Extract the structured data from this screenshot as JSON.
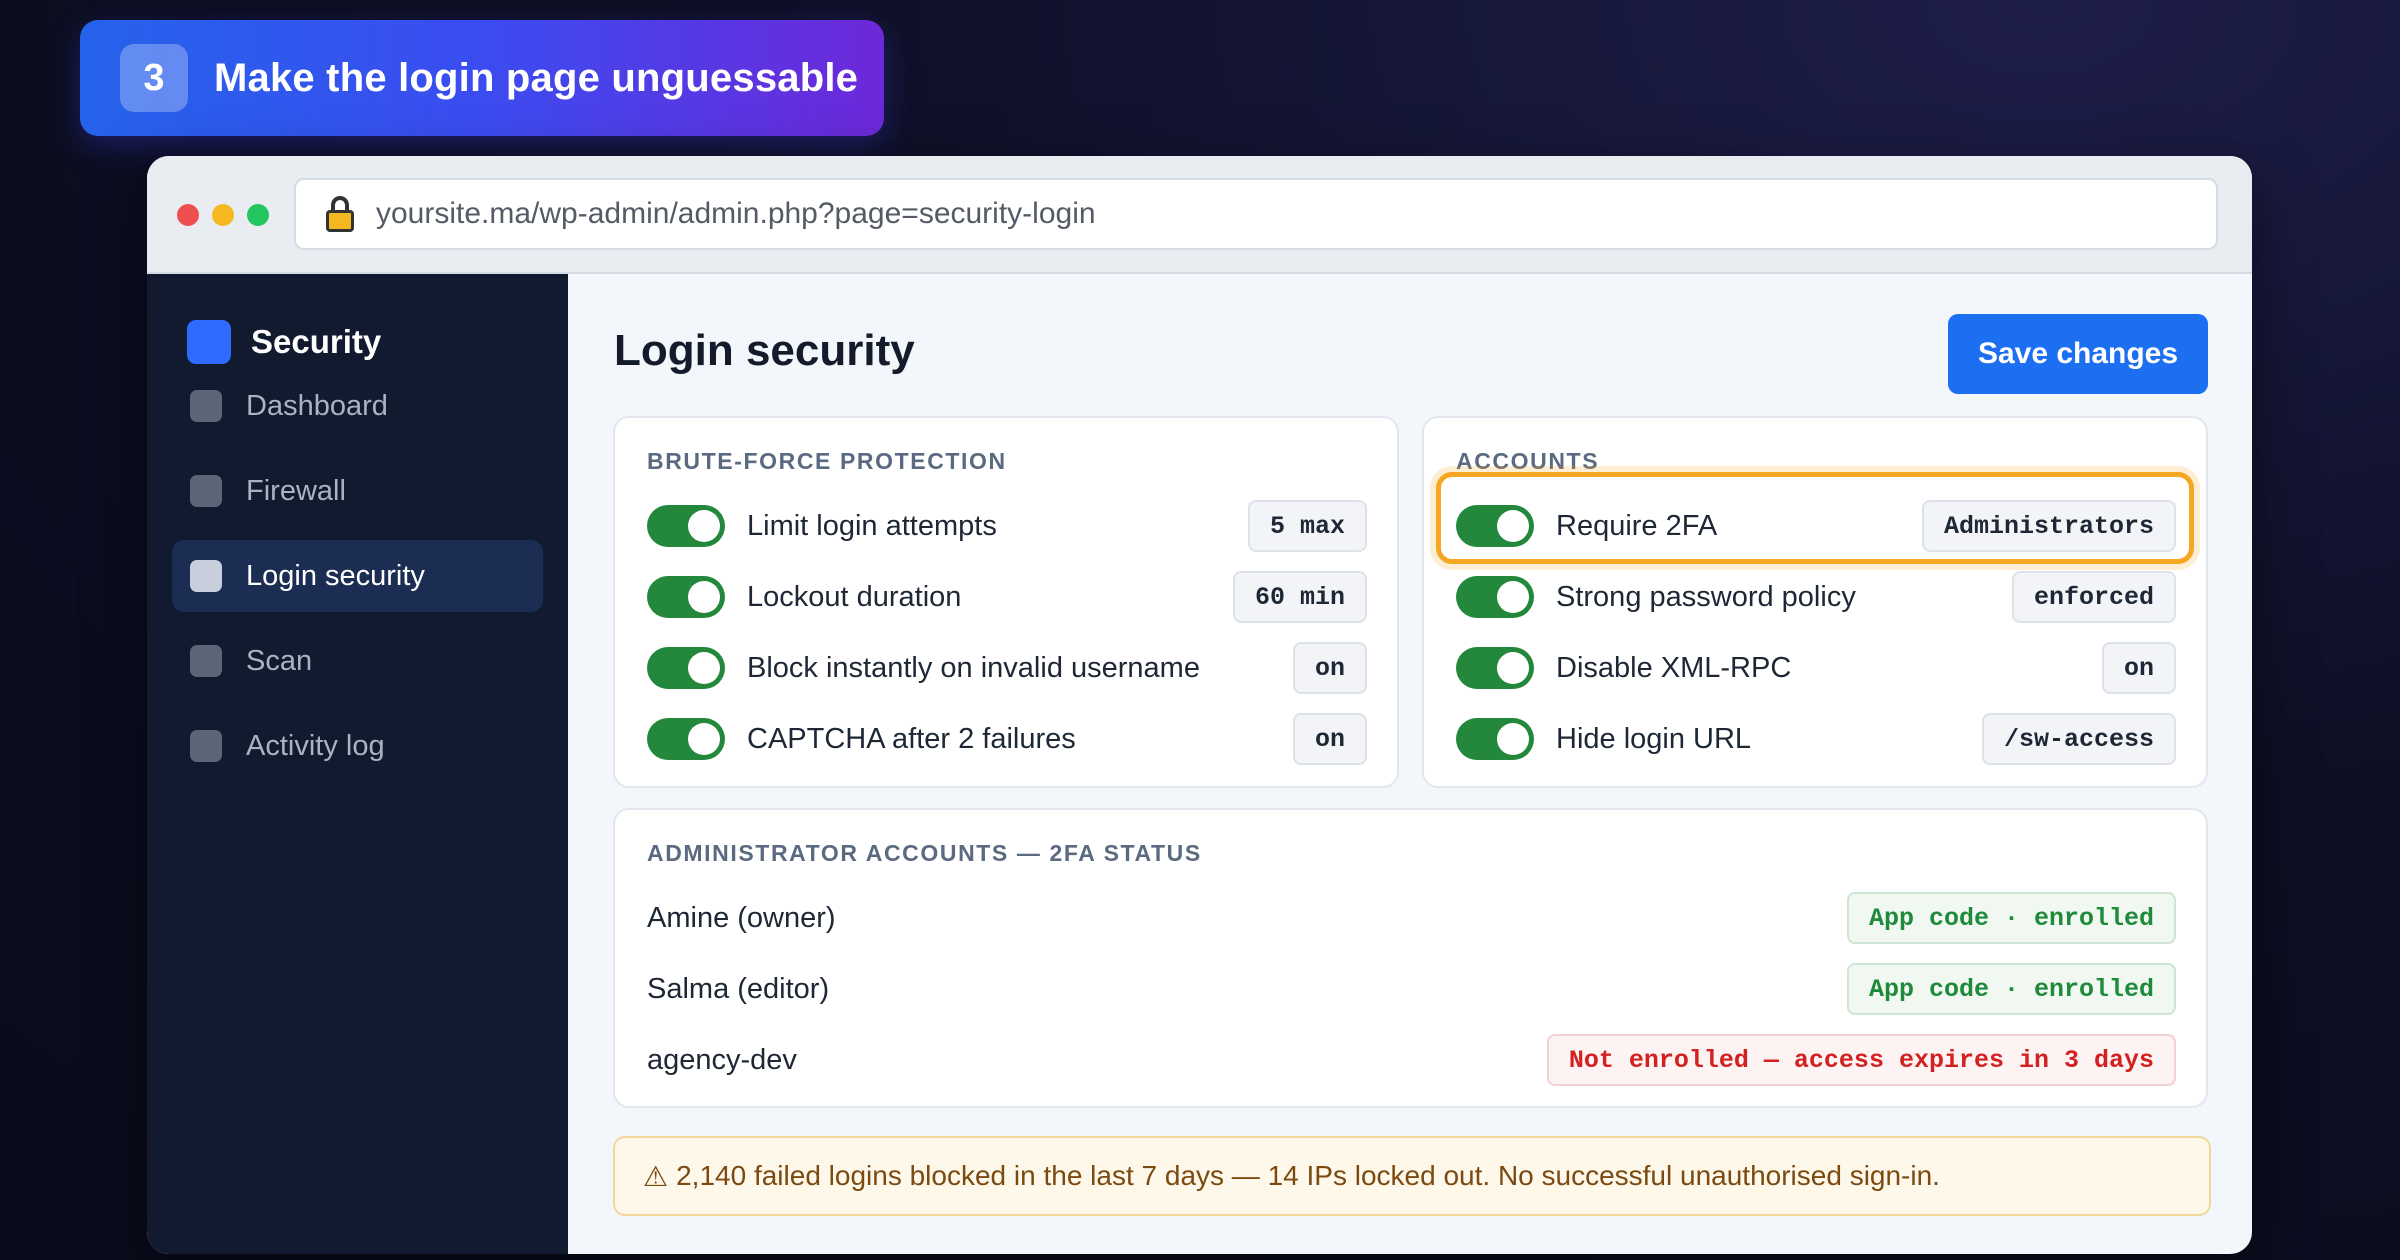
{
  "step": {
    "number": "3",
    "title": "Make the login page unguessable"
  },
  "browser": {
    "url": "yoursite.ma/wp-admin/admin.php?page=security-login"
  },
  "sidebar": {
    "brand": "Security",
    "items": [
      {
        "label": "Dashboard"
      },
      {
        "label": "Firewall"
      },
      {
        "label": "Login security"
      },
      {
        "label": "Scan"
      },
      {
        "label": "Activity log"
      }
    ]
  },
  "main": {
    "title": "Login security",
    "save_label": "Save changes",
    "brute_force": {
      "heading": "BRUTE-FORCE PROTECTION",
      "rows": [
        {
          "label": "Limit login attempts",
          "value": "5 max",
          "enabled": true
        },
        {
          "label": "Lockout duration",
          "value": "60 min",
          "enabled": true
        },
        {
          "label": "Block instantly on invalid username",
          "value": "on",
          "enabled": true
        },
        {
          "label": "CAPTCHA after 2 failures",
          "value": "on",
          "enabled": true
        }
      ]
    },
    "accounts": {
      "heading": "ACCOUNTS",
      "rows": [
        {
          "label": "Require 2FA",
          "value": "Administrators",
          "enabled": true,
          "highlighted": true
        },
        {
          "label": "Strong password policy",
          "value": "enforced",
          "enabled": true
        },
        {
          "label": "Disable XML-RPC",
          "value": "on",
          "enabled": true
        },
        {
          "label": "Hide login URL",
          "value": "/sw-access",
          "enabled": true
        }
      ]
    },
    "admins": {
      "heading": "ADMINISTRATOR ACCOUNTS — 2FA STATUS",
      "rows": [
        {
          "name": "Amine (owner)",
          "status": "App code · enrolled",
          "state": "ok"
        },
        {
          "name": "Salma (editor)",
          "status": "App code · enrolled",
          "state": "ok"
        },
        {
          "name": "agency-dev",
          "status": "Not enrolled — access expires in 3 days",
          "state": "bad"
        }
      ]
    },
    "alert": {
      "icon": "⚠",
      "text": "2,140 failed logins blocked in the last 7 days — 14 IPs locked out. No successful unauthorised sign-in."
    }
  },
  "colors": {
    "accent": "#1d6ff2",
    "toggle_on": "#23883b",
    "highlight": "#f5a623",
    "ok": "#1f8a3a",
    "error": "#d32020",
    "sidebar_bg": "#111a2e"
  }
}
